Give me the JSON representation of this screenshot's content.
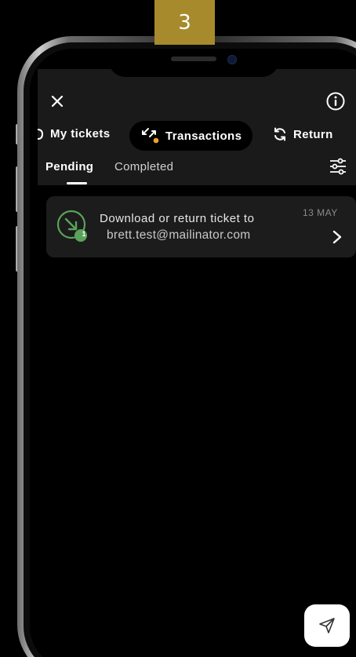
{
  "step": {
    "number": "3"
  },
  "header": {
    "tabs": [
      {
        "label": "My tickets"
      },
      {
        "label": "Transactions"
      },
      {
        "label": "Return"
      }
    ],
    "subtabs": [
      {
        "label": "Pending"
      },
      {
        "label": "Completed"
      }
    ]
  },
  "transactions": [
    {
      "title": "Download or return ticket to",
      "email": "brett.test@mailinator.com",
      "date": "13 MAY",
      "count": "1"
    }
  ],
  "icons": {
    "close": "close-icon",
    "info": "info-icon",
    "my_tickets": "ticket-icon",
    "transactions": "transfer-icon",
    "return": "refresh-icon",
    "filter": "filter-sliders-icon",
    "download": "download-arrow-icon",
    "chevron": "chevron-right-icon",
    "send": "send-icon"
  },
  "colors": {
    "badge": "#a78a2b",
    "background": "#000000",
    "header_bg": "#1a1a1a",
    "card_bg": "#1c1c1c",
    "accent_green": "#5aa35a",
    "notification_dot": "#f0a030"
  }
}
